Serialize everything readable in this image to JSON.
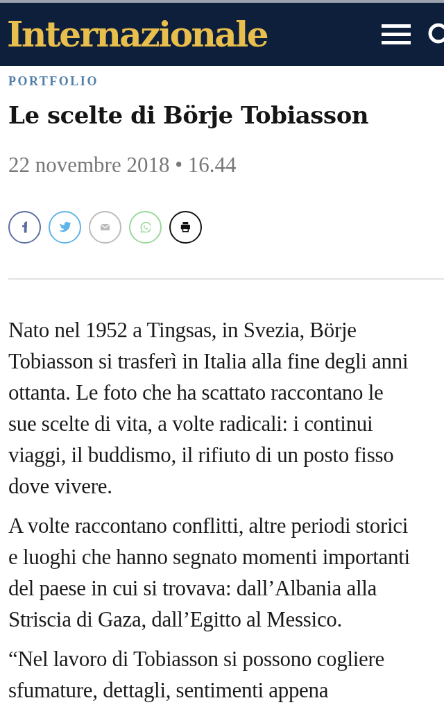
{
  "header": {
    "logo": "Internazionale"
  },
  "article": {
    "section": "PORTFOLIO",
    "title": "Le scelte di Börje Tobiasson",
    "date": "22 novembre 2018 • 16.44",
    "share": [
      {
        "kind": "facebook",
        "color": "#5a6ea0"
      },
      {
        "kind": "twitter",
        "color": "#5fb4e8"
      },
      {
        "kind": "email",
        "color": "#bbbbbb"
      },
      {
        "kind": "whatsapp",
        "color": "#9ad89a"
      },
      {
        "kind": "print",
        "color": "#111111"
      }
    ],
    "paragraphs": [
      {
        "lines": [
          "Nato nel 1952 a Tingsas, in Svezia, Börje",
          "Tobiasson si trasferì in Italia alla fine degli anni",
          "ottanta. Le foto che ha scattato raccontano le",
          "sue scelte di vita, a volte radicali: i continui",
          "viaggi, il buddismo, il rifiuto di un posto fisso",
          "dove vivere."
        ]
      },
      {
        "lines": [
          "A volte raccontano conflitti, altre periodi storici",
          "e luoghi che hanno segnato momenti importanti",
          "del paese in cui si trovava: dall’Albania alla",
          "Striscia di Gaza, dall’Egitto al Messico."
        ]
      },
      {
        "lines": [
          "“Nel lavoro di Tobiasson si possono cogliere",
          "sfumature, dettagli, sentimenti appena"
        ]
      }
    ]
  }
}
